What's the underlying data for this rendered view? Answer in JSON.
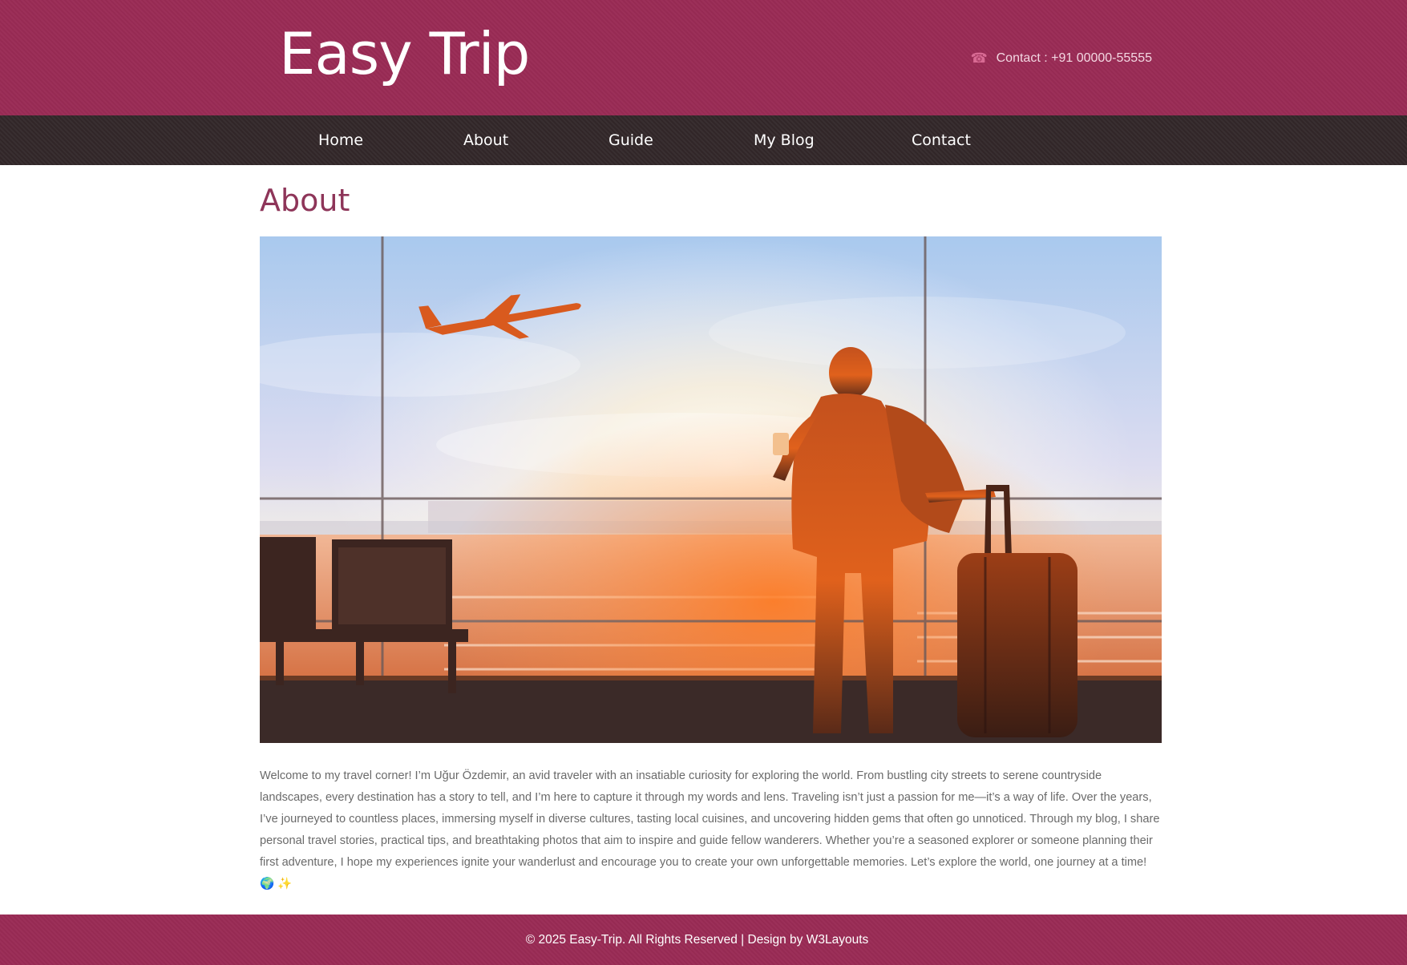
{
  "header": {
    "logo": "Easy Trip",
    "contact_icon": "phone-icon",
    "contact_text": "Contact : +91 00000-55555"
  },
  "nav": {
    "items": [
      {
        "label": "Home"
      },
      {
        "label": "About"
      },
      {
        "label": "Guide"
      },
      {
        "label": "My Blog"
      },
      {
        "label": "Contact"
      }
    ]
  },
  "main": {
    "title": "About",
    "hero_image": "traveler silhouette with suitcase at airport window, airplane taking off at sunset",
    "body": "Welcome to my travel corner! I’m Uğur Özdemir, an avid traveler with an insatiable curiosity for exploring the world. From bustling city streets to serene countryside landscapes, every destination has a story to tell, and I’m here to capture it through my words and lens. Traveling isn’t just a passion for me—it’s a way of life. Over the years, I’ve journeyed to countless places, immersing myself in diverse cultures, tasting local cuisines, and uncovering hidden gems that often go unnoticed. Through my blog, I share personal travel stories, practical tips, and breathtaking photos that aim to inspire and guide fellow wanderers. Whether you’re a seasoned explorer or someone planning their first adventure, I hope my experiences ignite your wanderlust and encourage you to create your own unforgettable memories. Let’s explore the world, one journey at a time! 🌍 ✨"
  },
  "footer": {
    "text": "© 2025 Easy-Trip. All Rights Reserved | Design by W3Layouts"
  },
  "colors": {
    "brand": "#9a2b55",
    "nav_bg": "#33282a",
    "title": "#8e3559"
  }
}
